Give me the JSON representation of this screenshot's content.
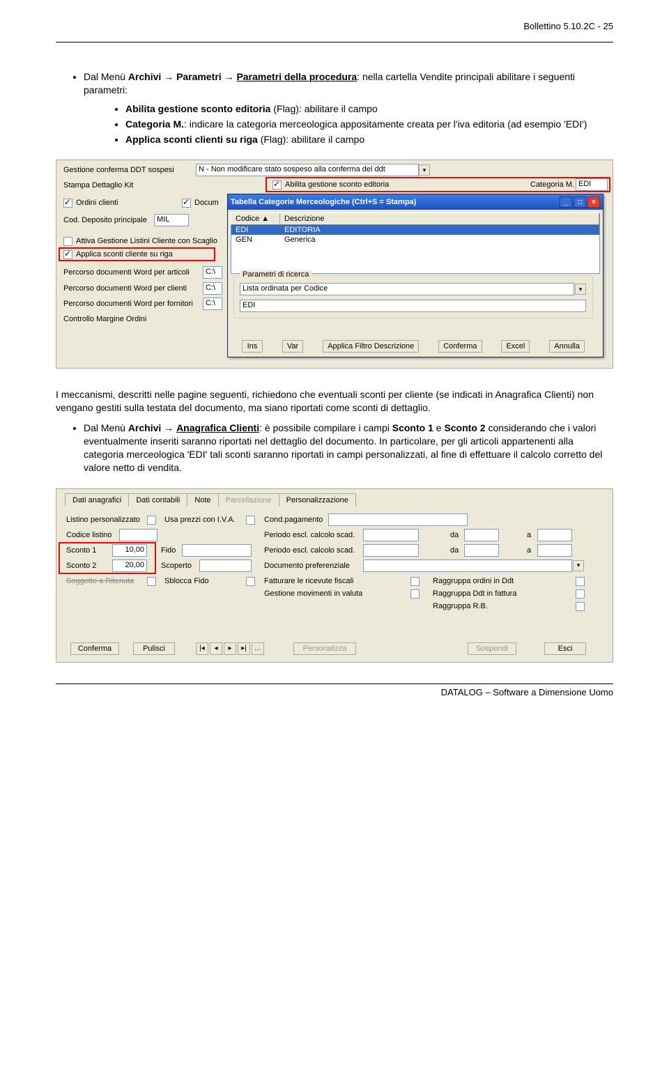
{
  "header": {
    "page_label": "Bollettino 5.10.2C - 25"
  },
  "para1": {
    "prefix": "Dal Menù ",
    "bold1": "Archivi",
    "arrow": " → ",
    "bold2": "Parametri",
    "arrow2": " → ",
    "bold3_u": "Parametri della procedura",
    "rest": ": nella cartella Vendite principali abilitare i seguenti parametri:"
  },
  "bullets1": {
    "b1a": "Abilita gestione sconto editoria",
    "b1b": " (Flag): abilitare il campo",
    "b2a": "Categoria M.",
    "b2b": ": indicare la categoria merceologica appositamente creata per l'iva editoria (ad esempio 'EDI')",
    "b3a": "Applica sconti clienti su riga",
    "b3b": " (Flag): abilitare il campo"
  },
  "ss1": {
    "gest_conf": "Gestione conferma DDT sospesi",
    "nondmod": "N - Non modificare stato sospeso alla conferma del ddt",
    "stampa": "Stampa Dettaglio Kit",
    "abilita": "Abilita gestione sconto editoria",
    "catm": "Categoria M.",
    "catm_val": "EDI",
    "ordini": "Ordini clienti",
    "docum": "Docum",
    "cod_dep": "Cod. Deposito principale",
    "mil": "MIL",
    "attiva_list": "Attiva Gestione Listini Cliente con Scaglio",
    "applica_sc": "Applica sconti cliente su riga",
    "perc_art": "Percorso documenti Word per articoli",
    "perc_cli": "Percorso documenti Word  per clienti",
    "perc_for": "Percorso documenti Word  per fornitori",
    "controllo": "Controllo Margine Ordini",
    "cval": "C:\\",
    "xpwin_title": "Tabella Categorie Merceologiche (Ctrl+S = Stampa)",
    "col_cod": "Codice",
    "col_desc": "Descrizione",
    "row1_c": "EDI",
    "row1_d": "EDITORIA",
    "row2_c": "GEN",
    "row2_d": "Generica",
    "param_ric": "Parametri di ricerca",
    "lista_ord": "Lista ordinata per Codice",
    "edi": "EDI",
    "btn_ins": "Ins",
    "btn_var": "Var",
    "btn_filtro": "Applica Filtro Descrizione",
    "btn_conf": "Conferma",
    "btn_excel": "Excel",
    "btn_ann": "Annulla"
  },
  "para2": "I meccanismi, descritti nelle pagine seguenti, richiedono che eventuali sconti per cliente (se indicati in Anagrafica Clienti) non vengano gestiti sulla testata del documento, ma siano riportati come sconti di dettaglio.",
  "para3": {
    "prefix": "Dal Menù ",
    "bold1": "Archivi",
    "arrow": " → ",
    "bold2_u": "Anagrafica Clienti",
    "mid": ": è possibile compilare i campi ",
    "bold3": "Sconto 1",
    "mid2": "  e ",
    "bold4": "Sconto 2",
    "rest": " considerando che i valori eventualmente inseriti saranno riportati nel dettaglio del documento. In particolare, per gli articoli appartenenti alla categoria merceologica 'EDI' tali sconti saranno riportati in campi personalizzati, al fine di effettuare il calcolo corretto del valore netto di vendita."
  },
  "ss2": {
    "tabs": [
      "Dati anagrafici",
      "Dati contabili",
      "Note",
      "Parcellazione",
      "Personalizzazione"
    ],
    "listino_p": "Listino personalizzato",
    "usa_prezzi": "Usa prezzi con I.V.A.",
    "cond_pag": "Cond.pagamento",
    "cod_list": "Codice listino",
    "periodo": "Periodo escl. calcolo scad.",
    "da": "da",
    "a": "a",
    "sconto1": "Sconto 1",
    "sconto1_v": "10,00",
    "sconto2": "Sconto 2",
    "sconto2_v": "20,00",
    "fido": "Fido",
    "scoperto": "Scoperto",
    "sogg": "Soggetto a Ritenuta",
    "sblocca": "Sblocca Fido",
    "doc_pref": "Documento preferenziale",
    "fatt_ric": "Fatturare le ricevute fiscali",
    "gest_mov": "Gestione movimenti in valuta",
    "ragg_ord": "Raggruppa ordini in Ddt",
    "ragg_ddt": "Raggruppa Ddt in fattura",
    "ragg_rb": "Raggruppa R.B.",
    "btn_conf2": "Conferma",
    "btn_pul": "Pulisci",
    "btn_pers": "Personalizza",
    "btn_sosp": "Sospendi",
    "btn_esci": "Esci"
  },
  "footer": {
    "text": "DATALOG – Software a Dimensione Uomo"
  }
}
